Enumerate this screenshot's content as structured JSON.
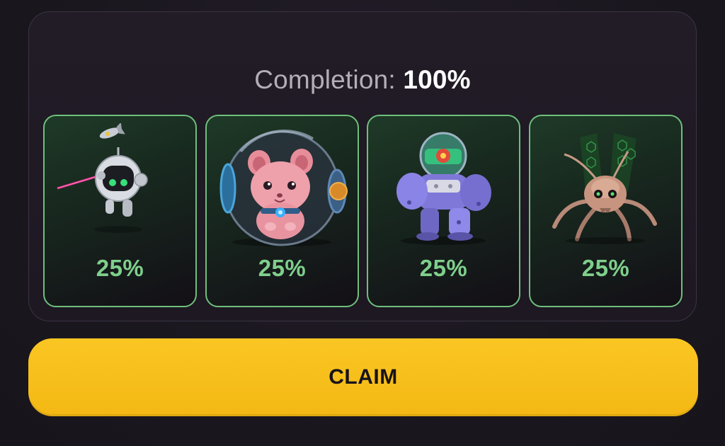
{
  "completion": {
    "label": "Completion:",
    "value": "100%"
  },
  "cards": [
    {
      "name": "Robot Drone",
      "icon": "robot-drone-icon",
      "percent": "25%"
    },
    {
      "name": "Hamster Ball",
      "icon": "hamster-ball-icon",
      "percent": "25%"
    },
    {
      "name": "Purple Mech",
      "icon": "purple-mech-icon",
      "percent": "25%"
    },
    {
      "name": "Spider Bug",
      "icon": "spider-bug-icon",
      "percent": "25%"
    }
  ],
  "claim": {
    "label": "CLAIM"
  },
  "colors": {
    "accent_green": "#7fcf8c",
    "card_border": "#6fbf7d",
    "claim_yellow": "#fbc623",
    "background": "#1c1820"
  }
}
